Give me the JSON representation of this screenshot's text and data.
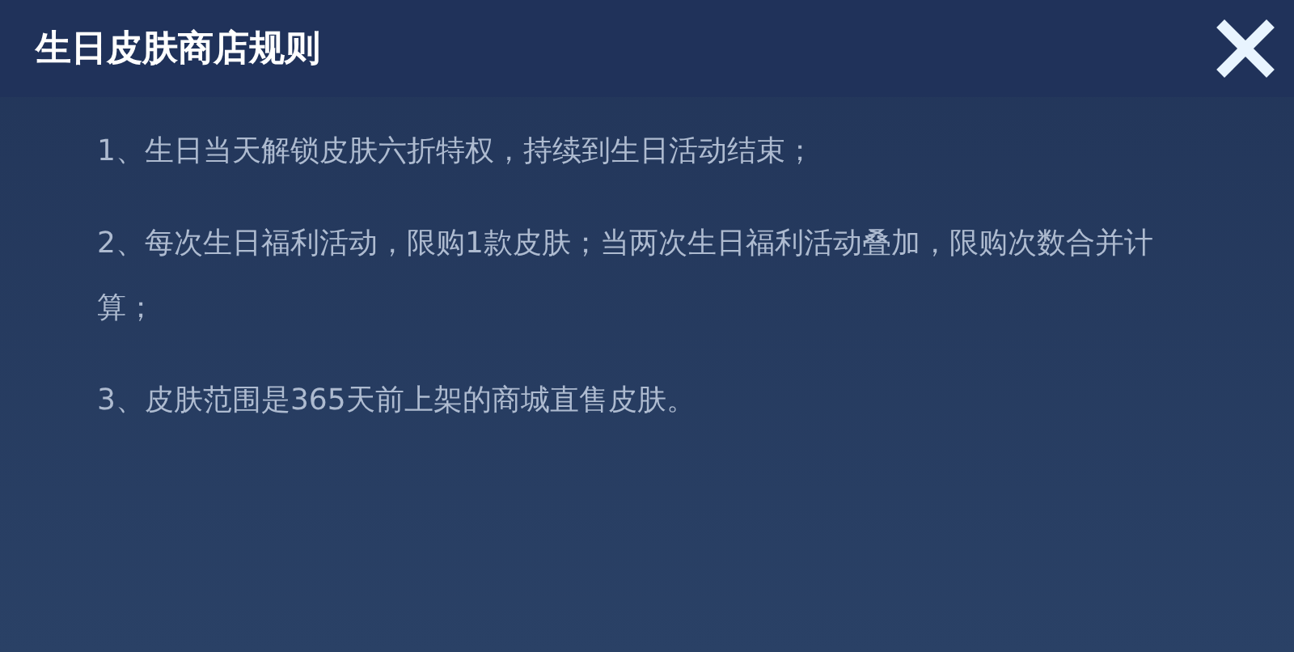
{
  "dialog": {
    "title": "生日皮肤商店规则",
    "rules": [
      "1、生日当天解锁皮肤六折特权，持续到生日活动结束；",
      "2、每次生日福利活动，限购1款皮肤；当两次生日福利活动叠加，限购次数合并计算；",
      "3、皮肤范围是365天前上架的商城直售皮肤。"
    ]
  }
}
